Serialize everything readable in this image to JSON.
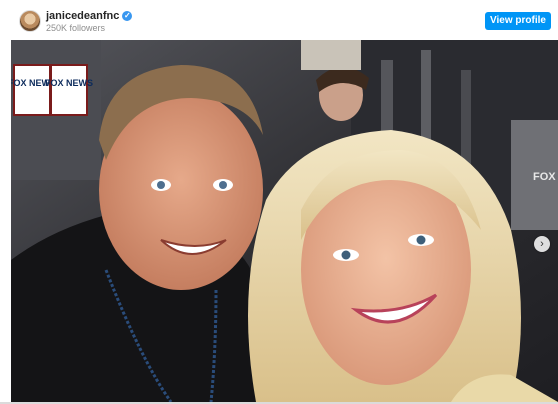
{
  "profile": {
    "username": "janicedeanfnc",
    "followers": "250K followers",
    "verified_icon": "verified-badge-icon",
    "view_profile_label": "View profile"
  },
  "photo": {
    "signs": [
      "FOX NEWS",
      "FOX NEWS"
    ],
    "right_sign": "FOX BU"
  },
  "carousel": {
    "next_icon": "chevron-right-icon",
    "next_glyph": "›"
  },
  "colors": {
    "accent": "#0095f6",
    "verified": "#3897f0"
  }
}
